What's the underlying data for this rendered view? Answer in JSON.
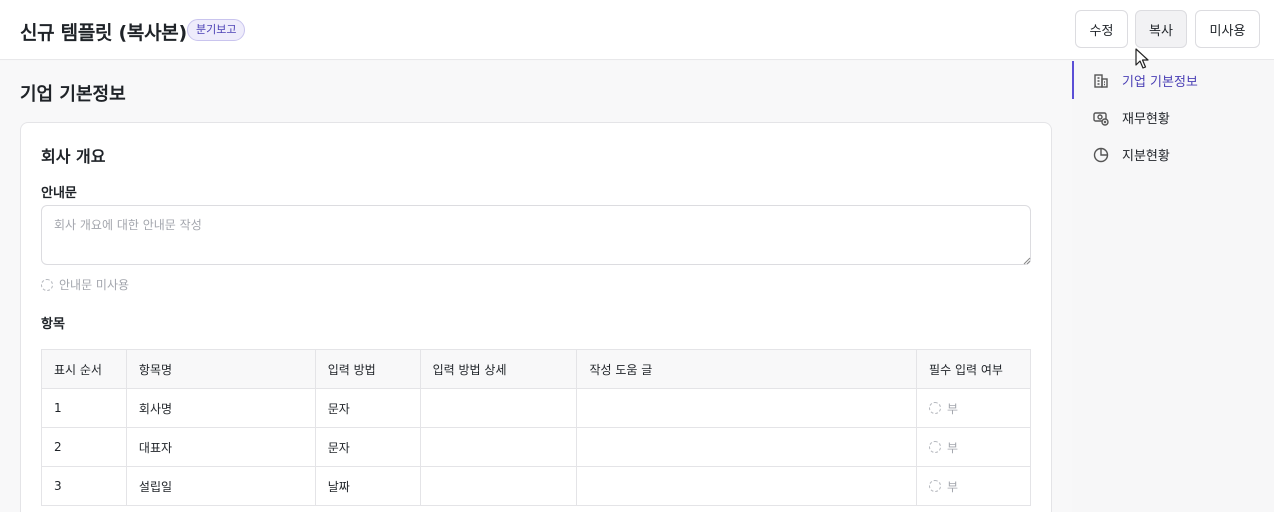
{
  "header": {
    "title": "신규 템플릿 (복사본)",
    "badge": "분기보고",
    "buttons": {
      "edit": "수정",
      "copy": "복사",
      "unused": "미사용"
    }
  },
  "main": {
    "section_title": "기업 기본정보",
    "card": {
      "title": "회사 개요",
      "guide_label": "안내문",
      "guide_placeholder": "회사 개요에 대한 안내문 작성",
      "guide_unused": "안내문 미사용",
      "items_label": "항목",
      "table": {
        "headers": [
          "표시 순서",
          "항목명",
          "입력 방법",
          "입력 방법 상세",
          "작성 도움 글",
          "필수 입력 여부"
        ],
        "rows": [
          {
            "order": "1",
            "name": "회사명",
            "method": "문자",
            "detail": "",
            "help": "",
            "required": "부"
          },
          {
            "order": "2",
            "name": "대표자",
            "method": "문자",
            "detail": "",
            "help": "",
            "required": "부"
          },
          {
            "order": "3",
            "name": "설립일",
            "method": "날짜",
            "detail": "",
            "help": "",
            "required": "부"
          }
        ]
      }
    }
  },
  "right_nav": {
    "items": [
      {
        "label": "기업 기본정보",
        "icon": "building-icon",
        "active": true
      },
      {
        "label": "재무현황",
        "icon": "money-icon",
        "active": false
      },
      {
        "label": "지분현황",
        "icon": "pie-chart-icon",
        "active": false
      }
    ]
  },
  "colors": {
    "accent": "#5b4fd6",
    "badge_bg": "#eeecfb"
  }
}
